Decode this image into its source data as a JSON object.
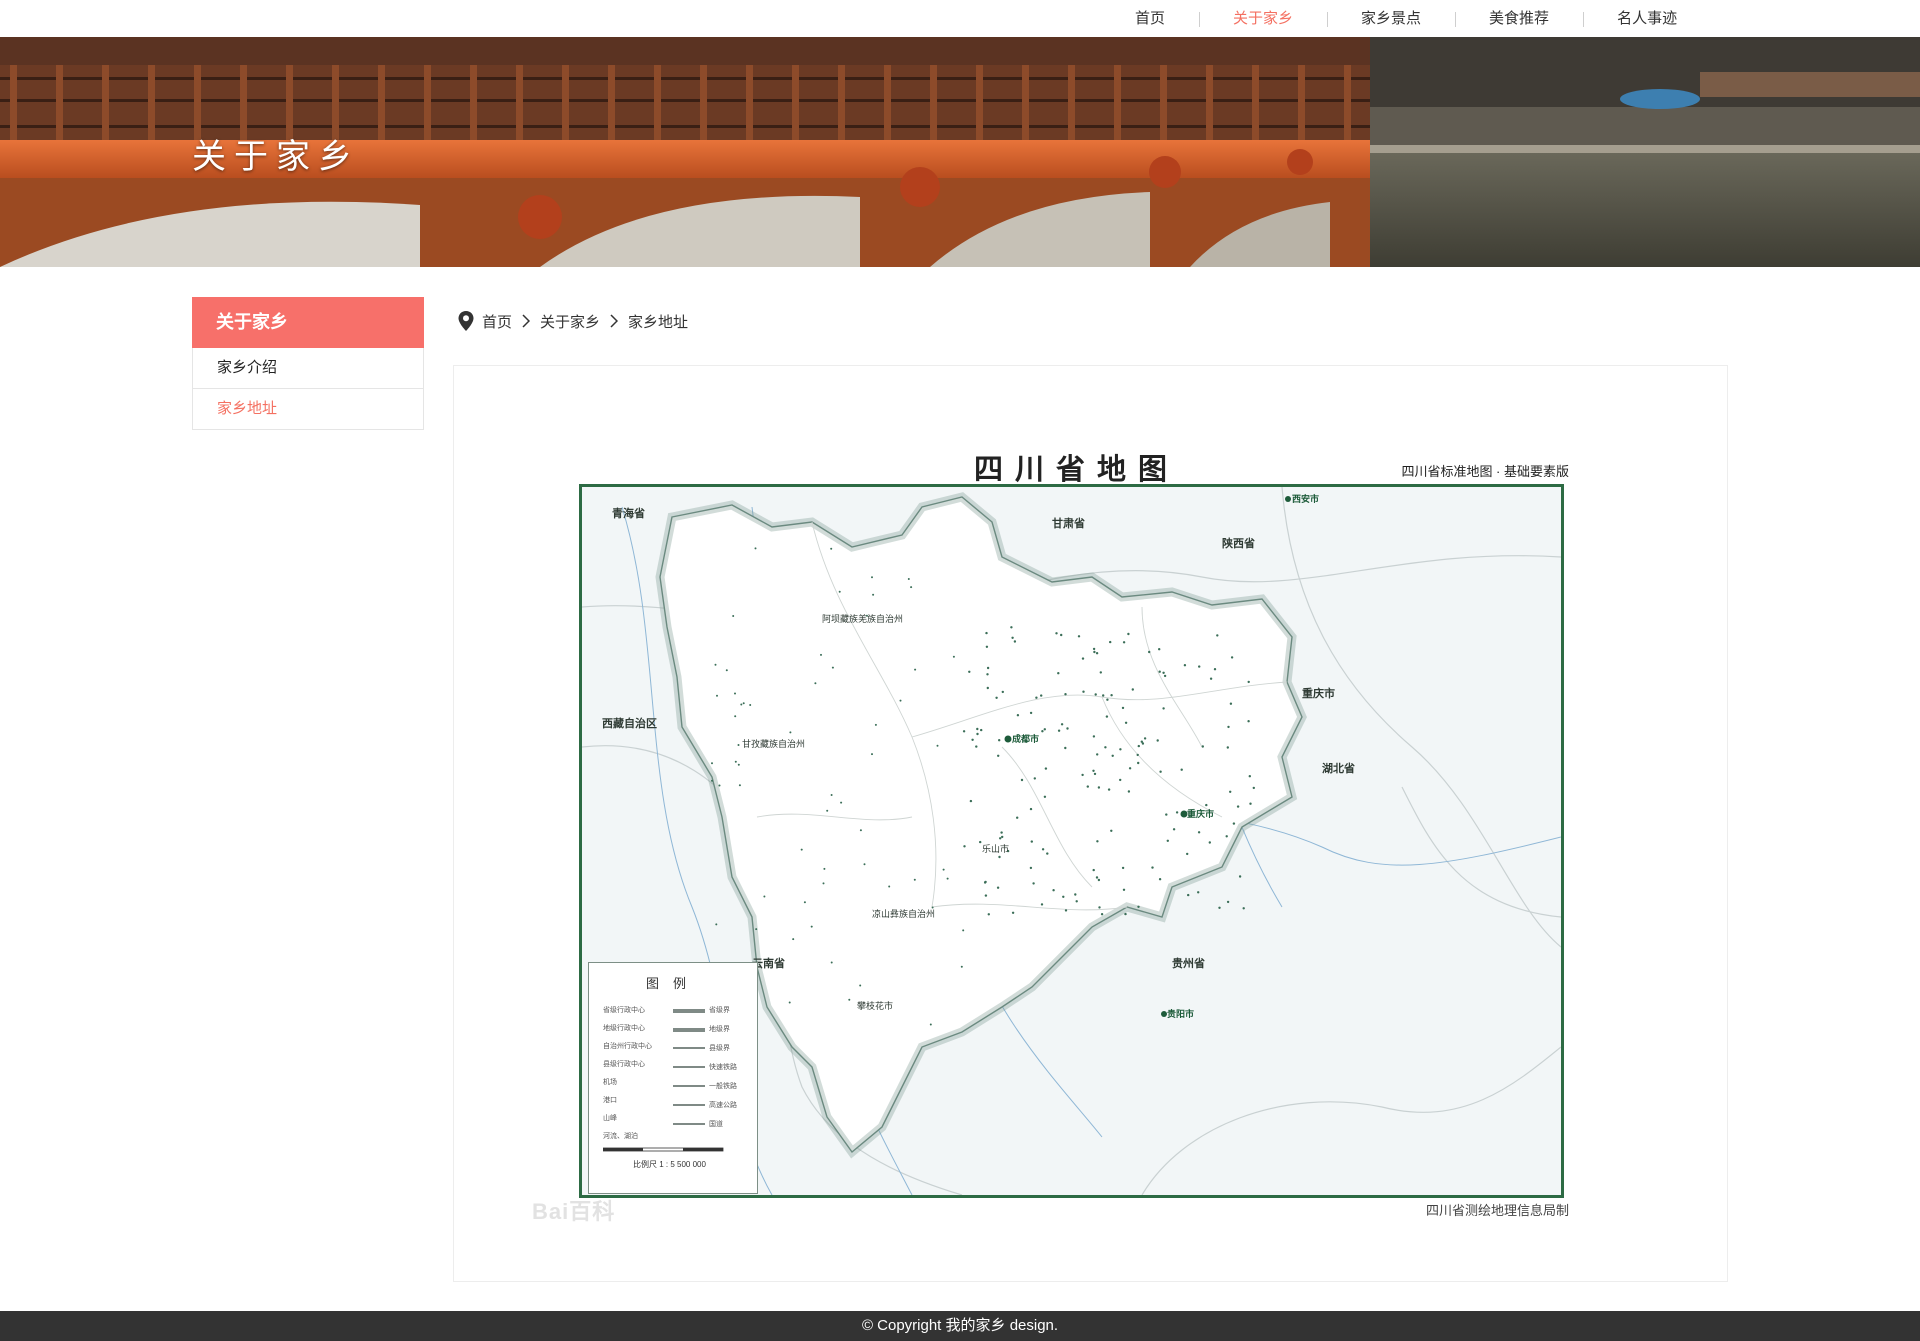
{
  "nav": {
    "items": [
      {
        "label": "首页"
      },
      {
        "label": "关于家乡"
      },
      {
        "label": "家乡景点"
      },
      {
        "label": "美食推荐"
      },
      {
        "label": "名人事迹"
      }
    ],
    "active_index": 1
  },
  "banner": {
    "title": "关于家乡"
  },
  "sidebar": {
    "heading": "关于家乡",
    "items": [
      {
        "label": "家乡介绍"
      },
      {
        "label": "家乡地址"
      }
    ],
    "active_index": 1
  },
  "breadcrumb": {
    "icon": "map-pin-icon",
    "items": [
      "首页",
      "关于家乡",
      "家乡地址"
    ]
  },
  "map": {
    "title": "四川省地图",
    "edition": "四川省标准地图 · 基础要素版",
    "credit": "四川省测绘地理信息局制",
    "watermark": "Bai百科",
    "region_labels": {
      "qinghai": "青海省",
      "gansu": "甘肃省",
      "shaanxi": "陕西省",
      "xizang": "西藏自治区",
      "chongqing": "重庆市",
      "yunnan": "云南省",
      "guizhou": "贵州省",
      "hubei": "湖北省",
      "chengdu": "成都市",
      "aba": "阿坝藏族羌族自治州",
      "ganzi": "甘孜藏族自治州",
      "liangshan": "凉山彝族自治州",
      "xian": "西安市",
      "chongqing_city": "重庆市",
      "guiyang": "贵阳市",
      "kunming_area": "攀枝花市",
      "leshan": "乐山市"
    },
    "legend": {
      "title": "图例",
      "rows": [
        "省级行政中心",
        "地级行政中心",
        "自治州行政中心",
        "县级行政中心",
        "机场",
        "港口",
        "山峰",
        "河流、湖泊"
      ],
      "line_rows": [
        "省级界",
        "地级界",
        "县级界",
        "快速铁路",
        "一般铁路",
        "高速公路",
        "国道"
      ],
      "scale": "比例尺  1 : 5 500 000"
    }
  },
  "footer": {
    "text": "©  Copyright  我的家乡  design."
  },
  "colors": {
    "accent": "#f47061",
    "sidebar_head": "#f7706a",
    "footer_bg": "#333333",
    "map_border": "#2d6b44"
  }
}
